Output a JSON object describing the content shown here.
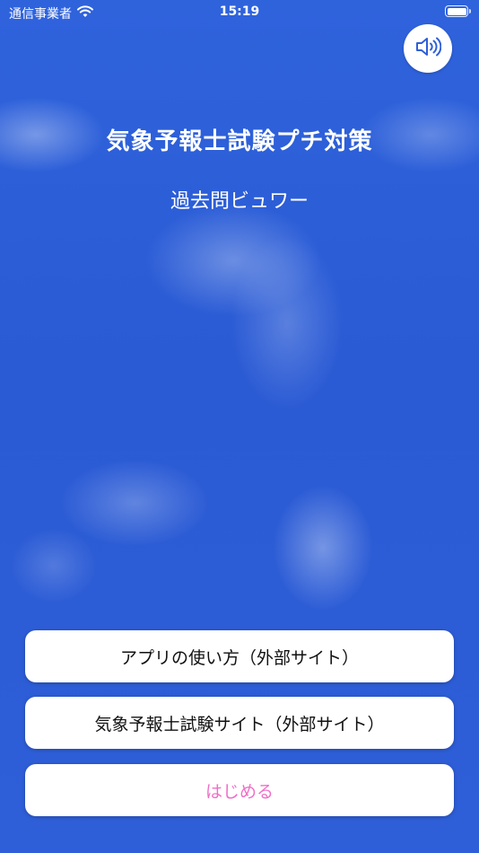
{
  "status_bar": {
    "carrier": "通信事業者",
    "time": "15:19"
  },
  "app": {
    "title": "気象予報士試験プチ対策",
    "subtitle": "過去問ビュワー"
  },
  "buttons": {
    "how_to_use": "アプリの使い方（外部サイト）",
    "exam_site": "気象予報士試験サイト（外部サイト）",
    "start": "はじめる"
  },
  "icons": {
    "sound": "speaker-icon",
    "wifi": "wifi-icon",
    "battery": "battery-icon"
  },
  "colors": {
    "sky_blue": "#2f5fd8",
    "start_text": "#f06ec8",
    "sound_icon": "#2f5fd8"
  }
}
